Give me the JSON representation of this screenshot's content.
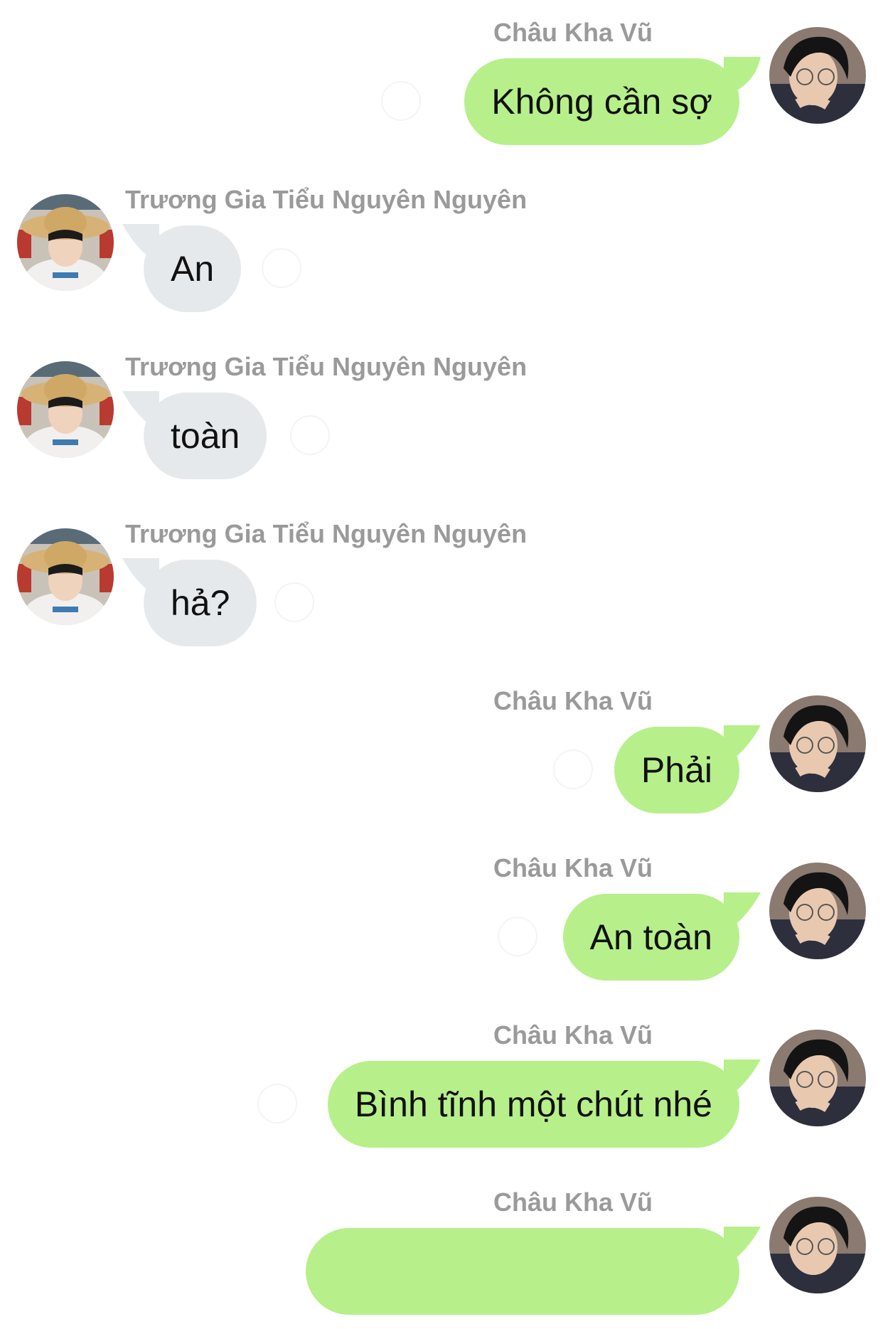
{
  "colors": {
    "outgoing_bubble": "#b7f08a",
    "incoming_bubble": "#e6e9ec",
    "sender_name": "#9a9a9a",
    "background": "#ffffff"
  },
  "messages": [
    {
      "sender": "Châu Kha Vũ",
      "text": "Không cần sợ",
      "direction": "outgoing",
      "avatar_icon": "avatar-glasses-boy"
    },
    {
      "sender": "Trương Gia Tiểu Nguyên Nguyên",
      "text": "An",
      "direction": "incoming",
      "avatar_icon": "avatar-straw-hat"
    },
    {
      "sender": "Trương Gia Tiểu Nguyên Nguyên",
      "text": "toàn",
      "direction": "incoming",
      "avatar_icon": "avatar-straw-hat"
    },
    {
      "sender": "Trương Gia Tiểu Nguyên Nguyên",
      "text": "hả?",
      "direction": "incoming",
      "avatar_icon": "avatar-straw-hat"
    },
    {
      "sender": "Châu Kha Vũ",
      "text": "Phải",
      "direction": "outgoing",
      "avatar_icon": "avatar-glasses-boy"
    },
    {
      "sender": "Châu Kha Vũ",
      "text": "An toàn",
      "direction": "outgoing",
      "avatar_icon": "avatar-glasses-boy"
    },
    {
      "sender": "Châu Kha Vũ",
      "text": "Bình tĩnh một chút nhé",
      "direction": "outgoing",
      "avatar_icon": "avatar-glasses-boy"
    },
    {
      "sender": "Châu Kha Vũ",
      "text": "",
      "direction": "outgoing",
      "avatar_icon": "avatar-glasses-boy"
    }
  ]
}
